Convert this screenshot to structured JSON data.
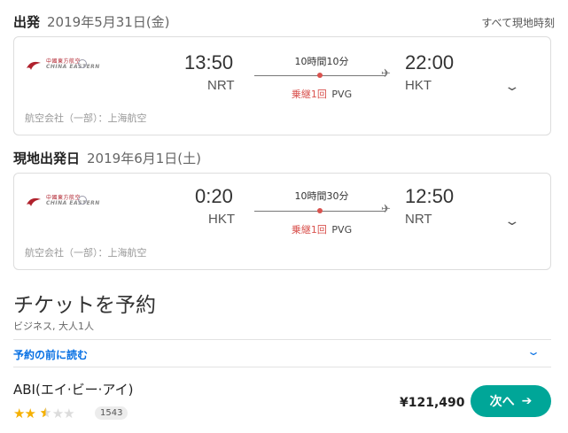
{
  "outbound": {
    "heading_strong": "出発",
    "heading_date": "2019年5月31日(金)",
    "local_time_note": "すべて現地時刻",
    "airline_logo_cn": "中國東方航空",
    "airline_logo_en": "CHINA EASTERN",
    "depart_time": "13:50",
    "depart_code": "NRT",
    "duration": "10時間10分",
    "stops": "乗継1回",
    "via": "PVG",
    "arrive_time": "22:00",
    "arrive_code": "HKT",
    "operator": "航空会社（一部）：上海航空"
  },
  "inbound": {
    "heading_strong": "現地出発日",
    "heading_date": "2019年6月1日(土)",
    "airline_logo_cn": "中國東方航空",
    "airline_logo_en": "CHINA EASTERN",
    "depart_time": "0:20",
    "depart_code": "HKT",
    "duration": "10時間30分",
    "stops": "乗継1回",
    "via": "PVG",
    "arrive_time": "12:50",
    "arrive_code": "NRT",
    "operator": "航空会社（一部）：上海航空"
  },
  "booking": {
    "title": "チケットを予約",
    "subtitle": "ビジネス, 大人1人",
    "read_before": "予約の前に読む",
    "provider_name": "ABI(エイ·ビー·アイ)",
    "rating_stars": 2.5,
    "rating_max": 5,
    "review_count": "1543",
    "price": "¥121,490",
    "next_label": "次へ"
  },
  "icons": {
    "plane": "✈",
    "chevron_down": "⌄",
    "arrow_right": "➔",
    "star": "★"
  },
  "colors": {
    "accent_green": "#00a698",
    "link_blue": "#0770e3",
    "stop_red": "#d9534f",
    "star_gold": "#f5b000"
  }
}
